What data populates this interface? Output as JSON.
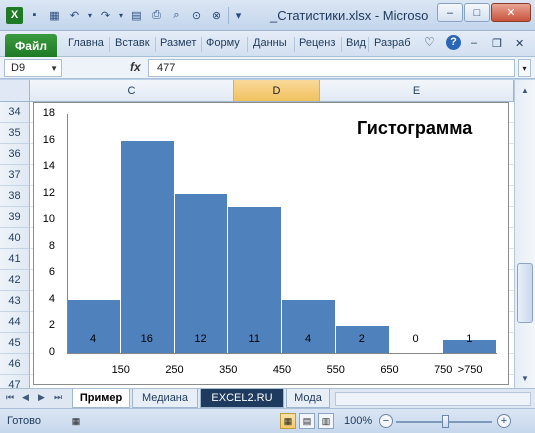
{
  "window": {
    "title": "_Статистики.xlsx - Microso",
    "minimize": "–",
    "maximize": "□",
    "close": "✕",
    "doc_minimize": "–",
    "doc_restore": "❐",
    "doc_close": "✕",
    "help": "?",
    "ribbon_toggle": "♡"
  },
  "quick_access": [
    {
      "icon": "excel-logo-icon",
      "glyph": "X"
    },
    {
      "icon": "save-icon",
      "glyph": "▪"
    },
    {
      "icon": "grid-icon",
      "glyph": "▦"
    },
    {
      "icon": "undo-icon",
      "glyph": "↶"
    },
    {
      "icon": "redo-icon",
      "glyph": "↷"
    },
    {
      "icon": "copy-icon",
      "glyph": "▤"
    },
    {
      "icon": "print-icon",
      "glyph": "⎙"
    },
    {
      "icon": "preview-icon",
      "glyph": "⌕"
    },
    {
      "icon": "refresh-icon",
      "glyph": "⊙"
    },
    {
      "icon": "stop-icon",
      "glyph": "⊗"
    },
    {
      "icon": "customize-icon",
      "glyph": "▾"
    }
  ],
  "ribbon": {
    "file_tab": "Файл",
    "tabs": [
      "Главна",
      "Вставк",
      "Размет",
      "Форму",
      "Данны",
      "Реценз",
      "Вид",
      "Разраб"
    ]
  },
  "formula_bar": {
    "name_box": "D9",
    "fx": "fx",
    "value": "477"
  },
  "columns": [
    "C",
    "D",
    "E"
  ],
  "selected_column": "D",
  "rows": [
    "34",
    "35",
    "36",
    "37",
    "38",
    "39",
    "40",
    "41",
    "42",
    "43",
    "44",
    "45",
    "46",
    "47"
  ],
  "chart_data": {
    "type": "bar",
    "title": "Гистограмма",
    "categories": [
      "150",
      "250",
      "350",
      "450",
      "550",
      "650",
      "750",
      ">750"
    ],
    "values": [
      4,
      16,
      12,
      11,
      4,
      2,
      0,
      1
    ],
    "data_labels": [
      "4",
      "16",
      "12",
      "11",
      "4",
      "2",
      "0",
      "1"
    ],
    "ylim": [
      0,
      18
    ],
    "yticks": [
      "0",
      "2",
      "4",
      "6",
      "8",
      "10",
      "12",
      "14",
      "16",
      "18"
    ],
    "xlabel": "",
    "ylabel": "",
    "bar_color": "#4f81bd",
    "grid": false,
    "legend": false
  },
  "sheet_tabs": [
    "Пример",
    "Медиана",
    "EXCEL2.RU",
    "Мода"
  ],
  "active_sheet": "Пример",
  "status": {
    "text": "Готово",
    "zoom": "100%",
    "zoom_out": "−",
    "zoom_in": "+"
  }
}
